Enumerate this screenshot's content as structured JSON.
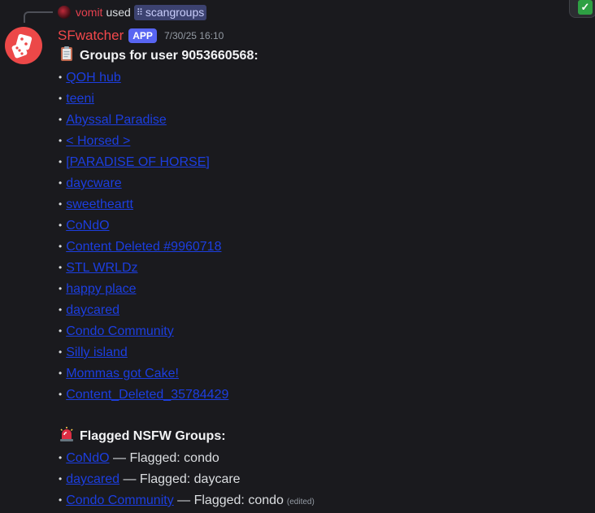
{
  "reply": {
    "username": "vomit",
    "used_text": "used",
    "command": "scangroups",
    "command_icon": "slash-command-icon"
  },
  "message": {
    "author": "SFwatcher",
    "badge": "APP",
    "timestamp": "7/30/25 16:10",
    "groups_heading": "Groups for user 9053660568:",
    "groups_heading_icon": "clipboard-icon",
    "groups": [
      "QOH hub",
      "teeni",
      "Abyssal Paradise",
      "< Horsed >",
      "[PARADISE OF HORSE]",
      "daycware",
      "sweetheartt",
      "CoNdO",
      "Content Deleted #9960718",
      "STL WRLDz",
      "happy place",
      "daycared",
      "Condo Community",
      "Silly island",
      "Mommas got Cake!",
      "Content_Deleted_35784429"
    ],
    "flagged_heading": "Flagged NSFW Groups:",
    "flagged_heading_icon": "siren-icon",
    "flagged": [
      {
        "group": "CoNdO",
        "sep": " — Flagged: ",
        "reason": "condo"
      },
      {
        "group": "daycared",
        "sep": " — Flagged: ",
        "reason": "daycare"
      },
      {
        "group": "Condo Community",
        "sep": " — Flagged: ",
        "reason": "condo"
      }
    ],
    "edited_label": "(edited)"
  },
  "colors": {
    "background": "#1a1a1e",
    "author": "#f2484b",
    "app_badge": "#5865f2",
    "link": "#1c3ee0",
    "avatar": "#ec4848"
  }
}
